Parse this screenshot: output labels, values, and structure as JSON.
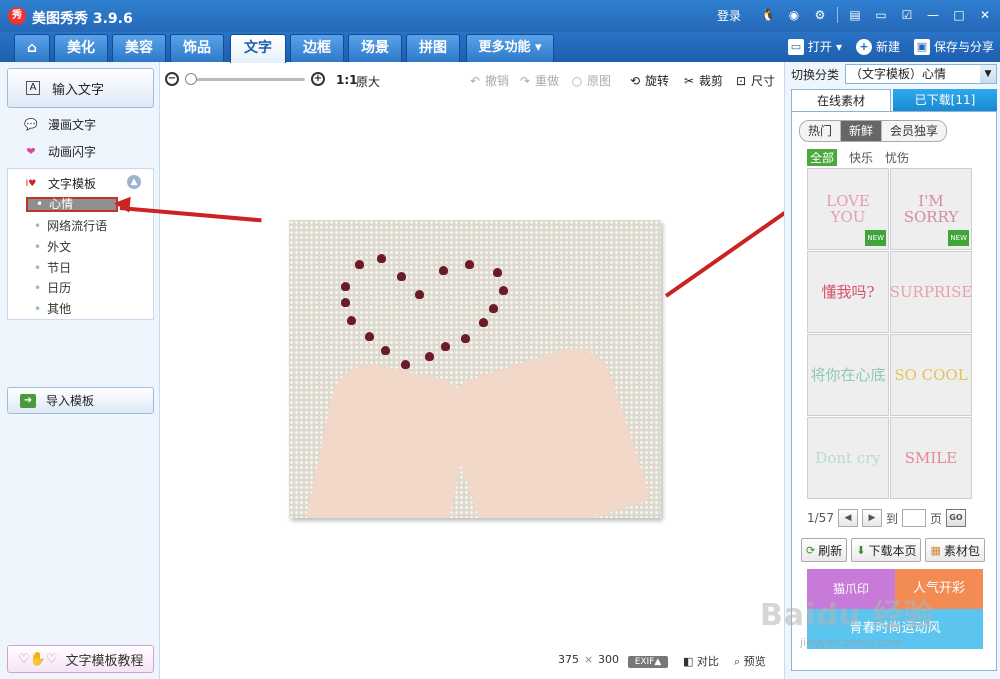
{
  "app": {
    "title": "美图秀秀 3.9.6",
    "logo_text": "秀"
  },
  "titlebar": {
    "login": "登录",
    "icons": [
      "qq-icon",
      "weibo-icon",
      "settings-icon",
      "feedback-icon",
      "message-icon",
      "skin-icon",
      "minimize-icon",
      "maximize-icon",
      "close-icon"
    ]
  },
  "tabs": [
    {
      "label": "",
      "icon": "home-icon"
    },
    {
      "label": "美化"
    },
    {
      "label": "美容"
    },
    {
      "label": "饰品"
    },
    {
      "label": "文字",
      "active": true
    },
    {
      "label": "边框"
    },
    {
      "label": "场景"
    },
    {
      "label": "拼图"
    },
    {
      "label": "更多功能 ▾"
    }
  ],
  "toolbar_actions": {
    "open": "打开",
    "new": "新建",
    "save_share": "保存与分享"
  },
  "left_panel": {
    "input_text": "输入文字",
    "manga_text": "漫画文字",
    "animated_text": "动画闪字",
    "template_header": "文字模板",
    "template_items": [
      "心情",
      "网络流行语",
      "外文",
      "节日",
      "日历",
      "其他"
    ],
    "selected_item": "心情",
    "import_template": "导入模板",
    "tutorial": "文字模板教程"
  },
  "center_toolbar": {
    "ratio": "1:1",
    "original_size": "原大",
    "undo": "撤销",
    "redo": "重做",
    "original": "原图",
    "rotate": "旋转",
    "crop": "裁剪",
    "size": "尺寸"
  },
  "status": {
    "width": "375",
    "times": "×",
    "height": "300",
    "exif": "EXIF▲",
    "compare": "对比",
    "preview": "预览"
  },
  "right_panel": {
    "switch_label": "切换分类",
    "category_select": "（文字模板）心情",
    "tab_online": "在线素材",
    "tab_downloaded": "已下载[11]",
    "pills": [
      "热门",
      "新鲜",
      "会员独享"
    ],
    "active_pill": "新鲜",
    "sub_filters": [
      "全部",
      "快乐",
      "忧伤"
    ],
    "tiles": [
      {
        "text": "LOVE YOU",
        "color": "#e79ab4",
        "new": true
      },
      {
        "text": "I'M SORRY",
        "color": "#d68aa8",
        "new": true
      },
      {
        "text": "懂我吗?",
        "color": "#d8506a",
        "new": false
      },
      {
        "text": "SURPRISE",
        "color": "#e8a0a8",
        "new": false
      },
      {
        "text": "将你在心底",
        "color": "#8cc9b0",
        "new": false
      },
      {
        "text": "SO COOL",
        "color": "#e2c45a",
        "new": false
      },
      {
        "text": "Dont cry",
        "color": "#b7dccb",
        "new": false
      },
      {
        "text": "SMILE",
        "color": "#e58a92",
        "new": false
      }
    ],
    "new_tag": "NEW",
    "pager": {
      "current": "1/57",
      "goto": "到",
      "page": "页",
      "go": "GO"
    },
    "actions": {
      "refresh": "刷新",
      "download_page": "下载本页",
      "material_pack": "素材包"
    },
    "banner": {
      "b1": "猫爪印",
      "b2": "人气开彩",
      "b3": "青春时尚运动风"
    }
  },
  "watermark": {
    "main": "Baidu 经验",
    "sub": "jingyan.baidu.com"
  }
}
